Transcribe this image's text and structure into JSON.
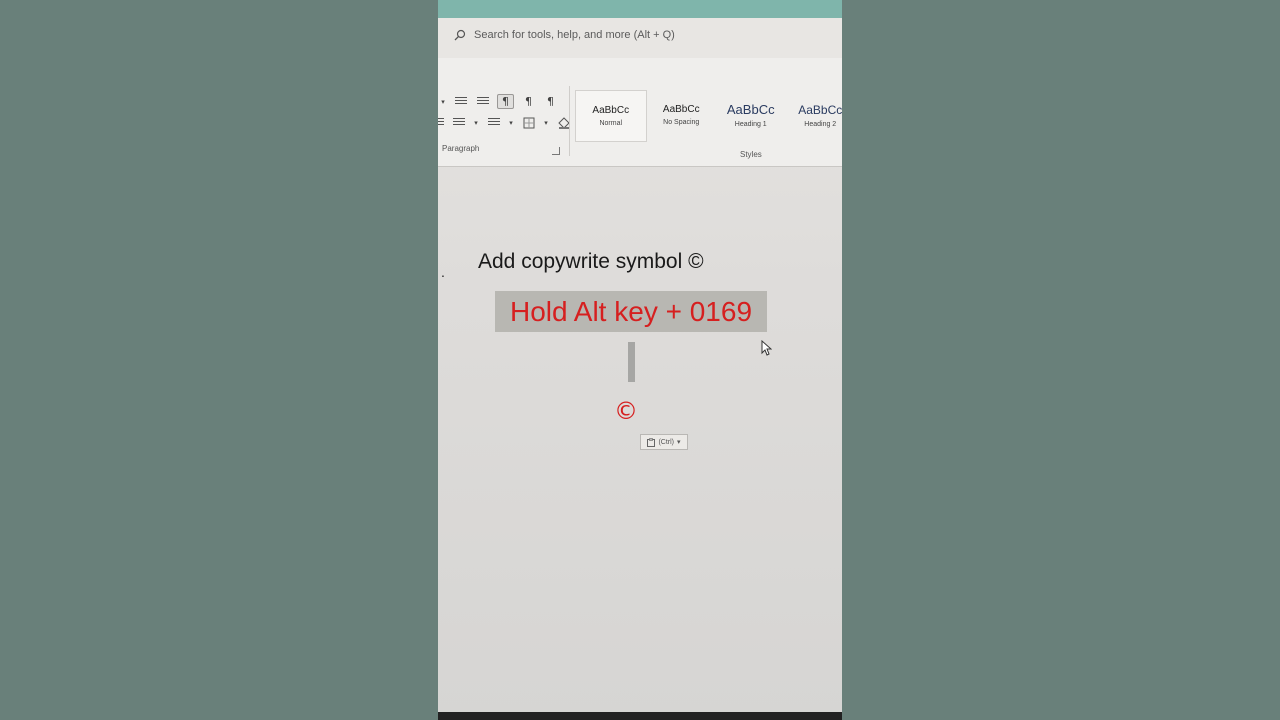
{
  "search": {
    "placeholder": "Search for tools, help, and more (Alt + Q)"
  },
  "ribbon": {
    "paragraph_label": "Paragraph",
    "styles_label": "Styles",
    "styles": [
      {
        "sample": "AaBbCc",
        "name": "Normal",
        "selected": true
      },
      {
        "sample": "AaBbCc",
        "name": "No Spacing",
        "selected": false
      },
      {
        "sample": "AaBbCc",
        "name": "Heading 1",
        "selected": false
      },
      {
        "sample": "AaBbCc",
        "name": "Heading 2",
        "selected": false
      }
    ],
    "icons": {
      "pilcrow_ltr": "¶",
      "pilcrow_rtl": "¶",
      "pilcrow": "¶"
    }
  },
  "document": {
    "bullet": ".",
    "heading": "Add copywrite symbol ©",
    "highlighted_text": "Hold Alt key + 0169",
    "inserted_symbol": "©"
  },
  "paste_options": {
    "label": "(Ctrl)",
    "caret": "▾"
  },
  "colors": {
    "background": "#69807a",
    "accent_text": "#d61f1f",
    "highlight": "#b8b7b2",
    "title_strip": "#7fb5ab"
  }
}
